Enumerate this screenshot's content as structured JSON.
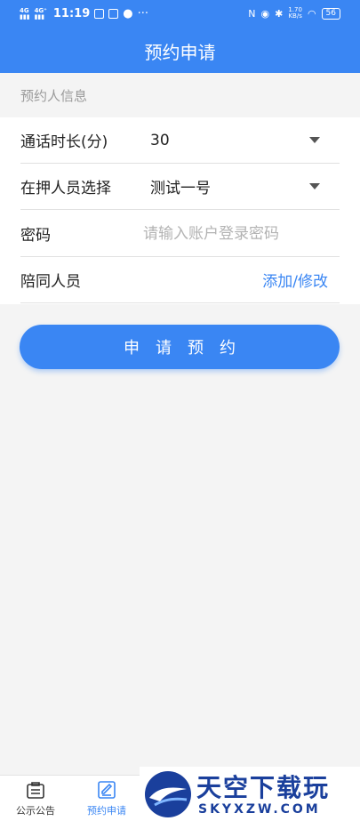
{
  "status_bar": {
    "network_1": "4G",
    "network_2": "4G⁺",
    "time": "11:19",
    "speed_value": "1.70",
    "speed_unit": "KB/s",
    "battery": "56"
  },
  "header": {
    "title": "预约申请"
  },
  "section": {
    "label": "预约人信息"
  },
  "form": {
    "duration": {
      "label": "通话时长(分)",
      "value": "30"
    },
    "detainee": {
      "label": "在押人员选择",
      "value": "测试一号"
    },
    "password": {
      "label": "密码",
      "placeholder": "请输入账户登录密码"
    },
    "companion": {
      "label": "陪同人员",
      "link": "添加/修改"
    }
  },
  "submit": {
    "label": "申请预约"
  },
  "tabs": [
    {
      "label": "公示公告",
      "icon": "notice-board-icon",
      "active": false
    },
    {
      "label": "预约申请",
      "icon": "edit-form-icon",
      "active": true
    }
  ],
  "watermark": {
    "brand": "天空下载玩",
    "url": "SKYXZW.COM"
  },
  "colors": {
    "primary": "#3a86f3",
    "background": "#f4f4f4"
  }
}
